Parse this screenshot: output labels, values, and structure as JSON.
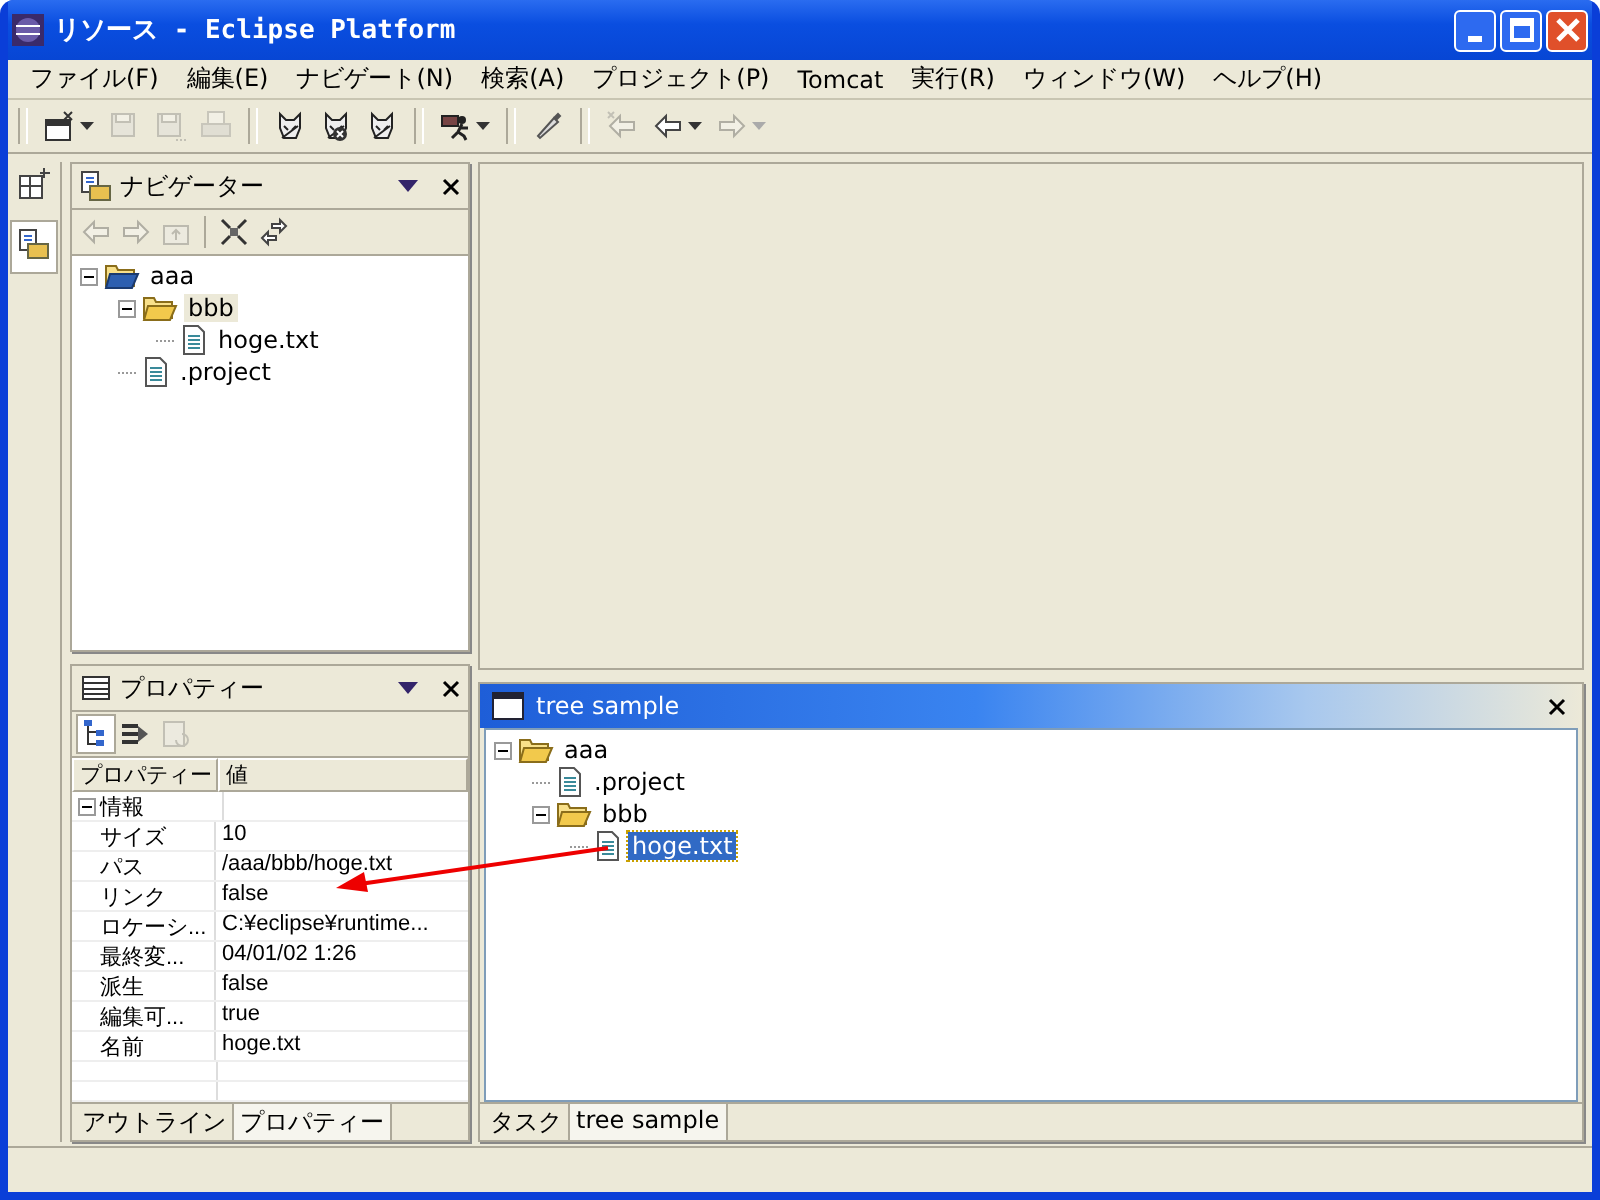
{
  "window": {
    "title": "リソース - Eclipse Platform"
  },
  "menu": [
    "ファイル(F)",
    "編集(E)",
    "ナビゲート(N)",
    "検索(A)",
    "プロジェクト(P)",
    "Tomcat",
    "実行(R)",
    "ウィンドウ(W)",
    "ヘルプ(H)"
  ],
  "toolbar": {
    "groups": [
      {
        "items": [
          {
            "kind": "new",
            "disabled": false,
            "dropdown": true
          },
          {
            "kind": "save",
            "disabled": true
          },
          {
            "kind": "save-all",
            "disabled": true
          },
          {
            "kind": "print",
            "disabled": true
          }
        ]
      },
      {
        "items": [
          {
            "kind": "tomcat-start",
            "disabled": false
          },
          {
            "kind": "tomcat-stop",
            "disabled": false
          },
          {
            "kind": "tomcat-restart",
            "disabled": false
          }
        ]
      },
      {
        "items": [
          {
            "kind": "run",
            "disabled": false,
            "dropdown": true
          }
        ]
      },
      {
        "items": [
          {
            "kind": "marker",
            "disabled": false
          }
        ]
      },
      {
        "items": [
          {
            "kind": "last-edit",
            "disabled": true
          },
          {
            "kind": "back",
            "disabled": false,
            "dropdown": true
          },
          {
            "kind": "forward",
            "disabled": true,
            "dropdown": true
          }
        ]
      }
    ]
  },
  "shortcut_bar": [
    {
      "kind": "open-perspective",
      "selected": false
    },
    {
      "kind": "resource",
      "selected": true
    }
  ],
  "navigator": {
    "title": "ナビゲーター",
    "toolbar": [
      {
        "kind": "back",
        "disabled": true
      },
      {
        "kind": "forward",
        "disabled": true
      },
      {
        "kind": "up",
        "disabled": true
      },
      {
        "kind": "collapse",
        "disabled": false
      },
      {
        "kind": "link",
        "disabled": false
      }
    ],
    "tree": [
      {
        "label": "aaa",
        "kind": "project",
        "expanded": true,
        "selected": false,
        "children": [
          {
            "label": "bbb",
            "kind": "folder",
            "expanded": true,
            "selected": true,
            "children": [
              {
                "label": "hoge.txt",
                "kind": "file",
                "selected": false
              }
            ]
          },
          {
            "label": ".project",
            "kind": "file",
            "selected": false
          }
        ]
      }
    ]
  },
  "properties": {
    "title": "プロパティー",
    "toolbar": [
      {
        "kind": "categories",
        "disabled": false,
        "pressed": true
      },
      {
        "kind": "filter",
        "disabled": false,
        "pressed": false
      },
      {
        "kind": "defaults",
        "disabled": true,
        "pressed": false
      }
    ],
    "columns": [
      "プロパティー",
      "値"
    ],
    "categories": [
      {
        "label": "情報",
        "expanded": true,
        "rows": [
          {
            "name": "サイズ",
            "value": "10"
          },
          {
            "name": "パス",
            "value": "/aaa/bbb/hoge.txt"
          },
          {
            "name": "リンク",
            "value": "false"
          },
          {
            "name": "ロケーシ...",
            "value": "C:¥eclipse¥runtime..."
          },
          {
            "name": "最終変...",
            "value": "04/01/02 1:26"
          },
          {
            "name": "派生",
            "value": "false"
          },
          {
            "name": "編集可...",
            "value": "true"
          },
          {
            "name": "名前",
            "value": "hoge.txt"
          }
        ]
      }
    ],
    "tabs": [
      {
        "label": "アウトライン",
        "selected": false
      },
      {
        "label": "プロパティー",
        "selected": true
      }
    ]
  },
  "tree_view": {
    "title": "tree sample",
    "active": true,
    "tree": [
      {
        "label": "aaa",
        "kind": "folder",
        "expanded": true,
        "selected": false,
        "children": [
          {
            "label": ".project",
            "kind": "file",
            "selected": false
          },
          {
            "label": "bbb",
            "kind": "folder",
            "expanded": true,
            "selected": false,
            "children": [
              {
                "label": "hoge.txt",
                "kind": "file",
                "selected": true
              }
            ]
          }
        ]
      }
    ],
    "tabs": [
      {
        "label": "タスク",
        "selected": false
      },
      {
        "label": "tree sample",
        "selected": true
      }
    ]
  }
}
